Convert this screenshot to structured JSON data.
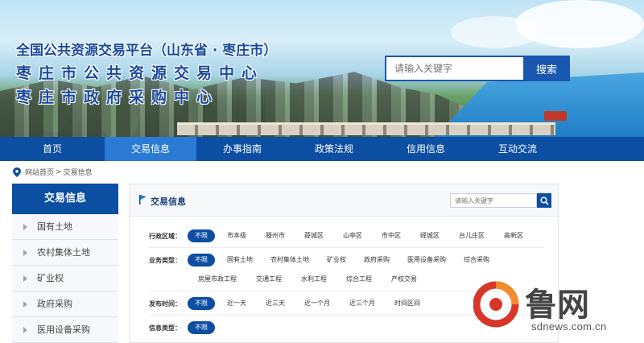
{
  "banner": {
    "title_main": "全国公共资源交易平台（山东省 · 枣庄市）",
    "title_sub_1": "枣庄市公共资源交易中心",
    "title_sub_2": "枣庄市政府采购中心"
  },
  "search": {
    "placeholder": "请输入关键字",
    "button_label": "搜索"
  },
  "nav": {
    "items": [
      "首页",
      "交易信息",
      "办事指南",
      "政策法规",
      "信用信息",
      "互动交流"
    ],
    "active_index": 1
  },
  "breadcrumb": {
    "home": "网站首页",
    "separator": ">",
    "current": "交易信息"
  },
  "sidebar": {
    "title": "交易信息",
    "items": [
      "国有土地",
      "农村集体土地",
      "矿业权",
      "政府采购",
      "医用设备采购"
    ]
  },
  "panel": {
    "title": "交易信息",
    "search_placeholder": "请输入关键字"
  },
  "filters": {
    "region": {
      "label": "行政区域：",
      "options": [
        "不限",
        "市本级",
        "滕州市",
        "薛城区",
        "山亭区",
        "市中区",
        "峄城区",
        "台儿庄区",
        "高新区"
      ]
    },
    "business": {
      "label": "业务类型：",
      "options_row1": [
        "不限",
        "国有土地",
        "农村集体土地",
        "矿业权",
        "政府采购",
        "医用设备采购",
        "综合采购"
      ],
      "options_row2": [
        "房屋市政工程",
        "交通工程",
        "水利工程",
        "综合工程",
        "产权交易"
      ]
    },
    "time": {
      "label": "发布时间：",
      "options": [
        "不限",
        "近一天",
        "近三天",
        "近一个月",
        "近三个月",
        "时间区间"
      ]
    },
    "info_type": {
      "label": "信息类型：",
      "options": [
        "不限"
      ]
    }
  },
  "watermark": {
    "brand": "鲁网",
    "site": "sdnews.com.cn"
  },
  "colors": {
    "primary": "#0b4ea2",
    "nav_active": "#2a7ad6",
    "watermark_red": "#d9362a"
  }
}
